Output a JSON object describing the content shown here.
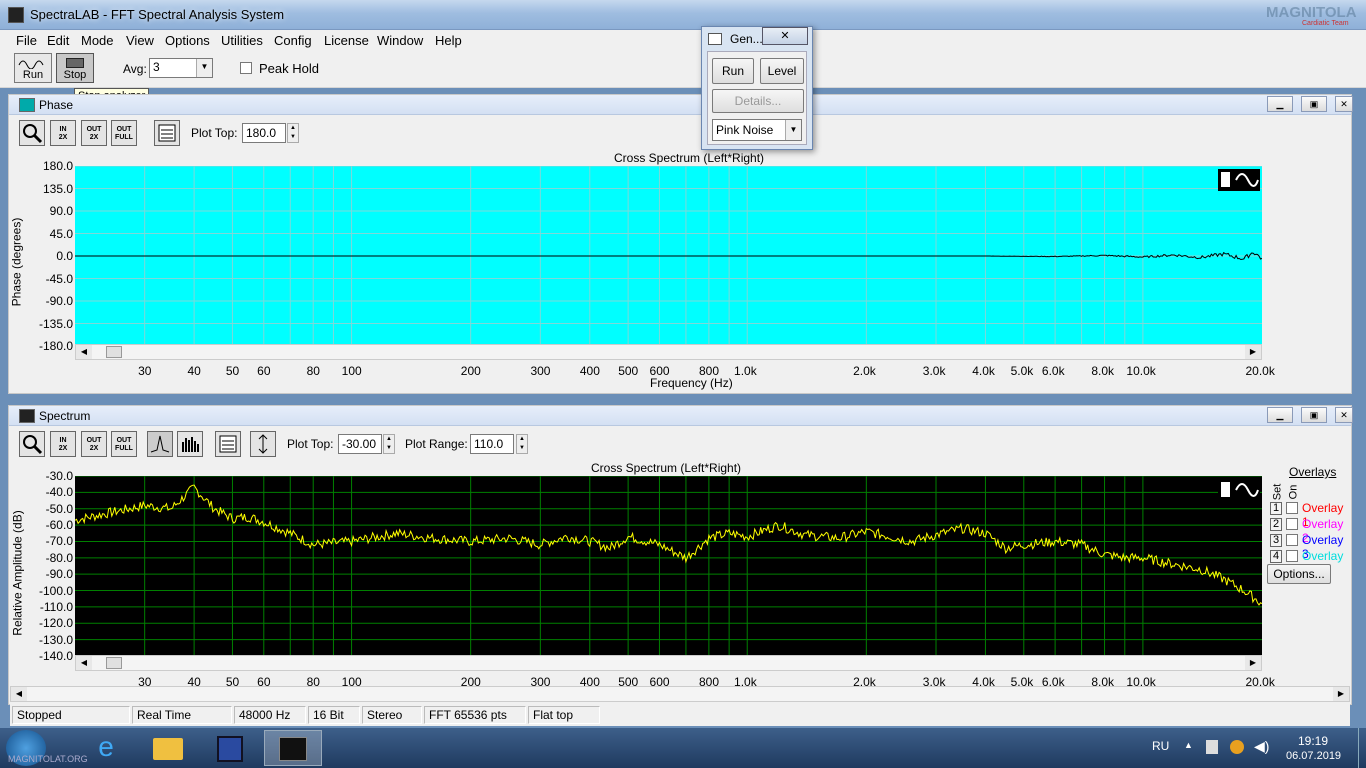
{
  "window": {
    "title": "SpectraLAB - FFT Spectral Analysis System",
    "watermark": "MAGNITOLA",
    "watermark_sub": "Cardiatic Team"
  },
  "menu": [
    "File",
    "Edit",
    "Mode",
    "View",
    "Options",
    "Utilities",
    "Config",
    "License",
    "Window",
    "Help"
  ],
  "toolbar": {
    "run_label": "Run",
    "stop_label": "Stop",
    "avg_label": "Avg:",
    "avg_value": "3",
    "peak_hold_label": "Peak Hold",
    "tooltip": "Stop analyzer"
  },
  "generator": {
    "title": "Gen...",
    "run_label": "Run",
    "level_label": "Level",
    "details_label": "Details...",
    "signal": "Pink Noise"
  },
  "phase": {
    "title": "Phase",
    "plot_top_label": "Plot Top:",
    "plot_top_value": "180.0",
    "chart_title": "Cross Spectrum (Left*Right)",
    "ylabel": "Phase (degrees)",
    "xlabel": "Frequency (Hz)"
  },
  "spectrum": {
    "title": "Spectrum",
    "plot_top_label": "Plot Top:",
    "plot_top_value": "-30.00",
    "plot_range_label": "Plot Range:",
    "plot_range_value": "110.0",
    "chart_title": "Cross Spectrum (Left*Right)",
    "ylabel": "Relative Amplitude (dB)",
    "overlays_title": "Overlays",
    "set_label": "Set",
    "on_label": "On",
    "options_label": "Options..."
  },
  "overlays": [
    {
      "set": "1",
      "name": "Overlay 1",
      "color": "#ff0000"
    },
    {
      "set": "2",
      "name": "Overlay 2",
      "color": "#ff00ff"
    },
    {
      "set": "3",
      "name": "Overlay 3",
      "color": "#0000ff"
    },
    {
      "set": "4",
      "name": "Overlay 4",
      "color": "#00ffff"
    }
  ],
  "zoom_buttons": [
    {
      "line1": "IN",
      "line2": "2X"
    },
    {
      "line1": "OUT",
      "line2": "2X"
    },
    {
      "line1": "OUT",
      "line2": "FULL"
    }
  ],
  "status": [
    "Stopped",
    "Real Time",
    "48000 Hz",
    "16 Bit",
    "Stereo",
    "FFT 65536 pts",
    "Flat top"
  ],
  "taskbar": {
    "lang": "RU",
    "time": "19:19",
    "date": "06.07.2019",
    "watermark_text": "MAGNITOLAT.ORG"
  },
  "colors": {
    "phase_bg": "#00ffff",
    "spectrum_bg": "#000000",
    "spectrum_grid": "#008000",
    "spectrum_trace": "#ffff00",
    "phase_trace": "#000000"
  },
  "chart_data": [
    {
      "type": "line",
      "title": "Cross Spectrum (Left*Right)",
      "xlabel": "Frequency (Hz)",
      "ylabel": "Phase (degrees)",
      "xscale": "log",
      "xlim": [
        20,
        20000
      ],
      "ylim": [
        -180,
        180
      ],
      "yticks": [
        "180.0",
        "135.0",
        "90.0",
        "45.0",
        "0.0",
        "-45.0",
        "-90.0",
        "-135.0",
        "-180.0"
      ],
      "xticks": [
        {
          "v": 30,
          "t": "30"
        },
        {
          "v": 40,
          "t": "40"
        },
        {
          "v": 50,
          "t": "50"
        },
        {
          "v": 60,
          "t": "60"
        },
        {
          "v": 80,
          "t": "80"
        },
        {
          "v": 100,
          "t": "100"
        },
        {
          "v": 200,
          "t": "200"
        },
        {
          "v": 300,
          "t": "300"
        },
        {
          "v": 400,
          "t": "400"
        },
        {
          "v": 500,
          "t": "500"
        },
        {
          "v": 600,
          "t": "600"
        },
        {
          "v": 800,
          "t": "800"
        },
        {
          "v": 1000,
          "t": "1.0k"
        },
        {
          "v": 2000,
          "t": "2.0k"
        },
        {
          "v": 3000,
          "t": "3.0k"
        },
        {
          "v": 4000,
          "t": "4.0k"
        },
        {
          "v": 5000,
          "t": "5.0k"
        },
        {
          "v": 6000,
          "t": "6.0k"
        },
        {
          "v": 8000,
          "t": "8.0k"
        },
        {
          "v": 10000,
          "t": "10.0k"
        },
        {
          "v": 20000,
          "t": "20.0k"
        }
      ],
      "x": [
        20,
        100,
        1000,
        4000,
        6000,
        8000,
        10000,
        12000,
        14000,
        16000,
        18000,
        19000,
        20000
      ],
      "y": [
        0,
        0,
        0,
        0,
        -1,
        1,
        -2,
        2,
        -3,
        4,
        -6,
        8,
        -5
      ]
    },
    {
      "type": "line",
      "title": "Cross Spectrum (Left*Right)",
      "ylabel": "Relative Amplitude (dB)",
      "xscale": "log",
      "xlim": [
        20,
        20000
      ],
      "ylim": [
        -140,
        -30
      ],
      "yticks": [
        "-30.0",
        "-40.0",
        "-50.0",
        "-60.0",
        "-70.0",
        "-80.0",
        "-90.0",
        "-100.0",
        "-110.0",
        "-120.0",
        "-130.0",
        "-140.0"
      ],
      "xticks": [
        {
          "v": 30,
          "t": "30"
        },
        {
          "v": 40,
          "t": "40"
        },
        {
          "v": 50,
          "t": "50"
        },
        {
          "v": 60,
          "t": "60"
        },
        {
          "v": 80,
          "t": "80"
        },
        {
          "v": 100,
          "t": "100"
        },
        {
          "v": 200,
          "t": "200"
        },
        {
          "v": 300,
          "t": "300"
        },
        {
          "v": 400,
          "t": "400"
        },
        {
          "v": 500,
          "t": "500"
        },
        {
          "v": 600,
          "t": "600"
        },
        {
          "v": 800,
          "t": "800"
        },
        {
          "v": 1000,
          "t": "1.0k"
        },
        {
          "v": 2000,
          "t": "2.0k"
        },
        {
          "v": 3000,
          "t": "3.0k"
        },
        {
          "v": 4000,
          "t": "4.0k"
        },
        {
          "v": 5000,
          "t": "5.0k"
        },
        {
          "v": 6000,
          "t": "6.0k"
        },
        {
          "v": 8000,
          "t": "8.0k"
        },
        {
          "v": 10000,
          "t": "10.0k"
        },
        {
          "v": 20000,
          "t": "20.0k"
        }
      ],
      "x": [
        20,
        25,
        30,
        35,
        40,
        45,
        50,
        55,
        60,
        70,
        80,
        100,
        130,
        160,
        200,
        250,
        300,
        350,
        400,
        450,
        500,
        600,
        700,
        800,
        900,
        1000,
        1200,
        1400,
        1700,
        2000,
        2300,
        2600,
        3000,
        3500,
        4000,
        4500,
        5000,
        6000,
        7000,
        8000,
        9000,
        10000,
        12000,
        14000,
        16000,
        18000,
        20000
      ],
      "y": [
        -57,
        -52,
        -48,
        -50,
        -37,
        -50,
        -56,
        -55,
        -58,
        -65,
        -72,
        -70,
        -65,
        -68,
        -70,
        -68,
        -72,
        -67,
        -70,
        -74,
        -67,
        -72,
        -80,
        -68,
        -65,
        -67,
        -60,
        -66,
        -68,
        -64,
        -67,
        -70,
        -66,
        -62,
        -65,
        -74,
        -72,
        -70,
        -72,
        -78,
        -80,
        -80,
        -84,
        -87,
        -93,
        -100,
        -108
      ]
    }
  ]
}
